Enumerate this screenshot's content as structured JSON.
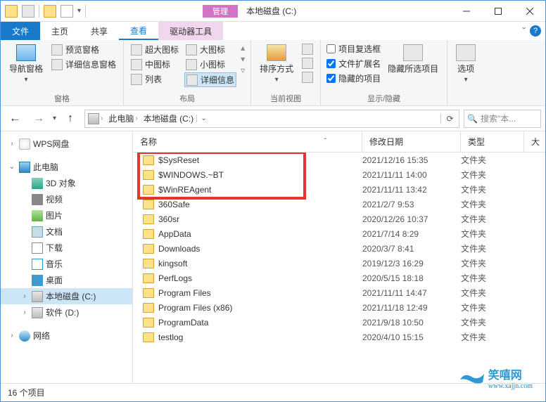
{
  "title": "本地磁盘 (C:)",
  "context_tab_header": "管理",
  "tabs": {
    "file": "文件",
    "home": "主页",
    "share": "共享",
    "view": "查看",
    "drive_tools": "驱动器工具"
  },
  "ribbon": {
    "nav_pane_label": "导航窗格",
    "preview_pane": "预览窗格",
    "details_pane": "详细信息窗格",
    "group_panes": "窗格",
    "extra_large_icons": "超大图标",
    "large_icons": "大图标",
    "medium_icons": "中图标",
    "small_icons": "小图标",
    "list": "列表",
    "details": "详细信息",
    "group_layout": "布局",
    "sort_by": "排序方式",
    "group_current_view": "当前视图",
    "item_checkboxes": "项目复选框",
    "file_ext": "文件扩展名",
    "hidden_items": "隐藏的项目",
    "hide_selected": "隐藏所选项目",
    "group_show_hide": "显示/隐藏",
    "options": "选项"
  },
  "breadcrumb": {
    "pc": "此电脑",
    "loc": "本地磁盘 (C:)"
  },
  "search_placeholder": "搜索\"本...",
  "sidebar": {
    "items": [
      {
        "label": "WPS网盘",
        "icon": "ic-wps",
        "tw": "›"
      },
      {
        "label": "此电脑",
        "icon": "ic-pc",
        "tw": "⌄"
      },
      {
        "label": "3D 对象",
        "icon": "ic-3d",
        "tw": ""
      },
      {
        "label": "视频",
        "icon": "ic-video",
        "tw": ""
      },
      {
        "label": "图片",
        "icon": "ic-pic",
        "tw": ""
      },
      {
        "label": "文档",
        "icon": "ic-doc",
        "tw": ""
      },
      {
        "label": "下载",
        "icon": "ic-dl",
        "tw": ""
      },
      {
        "label": "音乐",
        "icon": "ic-music",
        "tw": ""
      },
      {
        "label": "桌面",
        "icon": "ic-desk",
        "tw": ""
      },
      {
        "label": "本地磁盘 (C:)",
        "icon": "ic-drive",
        "tw": "›"
      },
      {
        "label": "软件 (D:)",
        "icon": "ic-drive",
        "tw": "›"
      },
      {
        "label": "网络",
        "icon": "ic-net",
        "tw": "›"
      }
    ]
  },
  "columns": {
    "name": "名称",
    "date": "修改日期",
    "type": "类型",
    "size": "大"
  },
  "rows": [
    {
      "name": "$SysReset",
      "date": "2021/12/16 15:35",
      "type": "文件夹"
    },
    {
      "name": "$WINDOWS.~BT",
      "date": "2021/11/11 14:00",
      "type": "文件夹"
    },
    {
      "name": "$WinREAgent",
      "date": "2021/11/11 13:42",
      "type": "文件夹"
    },
    {
      "name": "360Safe",
      "date": "2021/2/7 9:53",
      "type": "文件夹"
    },
    {
      "name": "360sr",
      "date": "2020/12/26 10:37",
      "type": "文件夹"
    },
    {
      "name": "AppData",
      "date": "2021/7/14 8:29",
      "type": "文件夹"
    },
    {
      "name": "Downloads",
      "date": "2020/3/7 8:41",
      "type": "文件夹"
    },
    {
      "name": "kingsoft",
      "date": "2019/12/3 16:29",
      "type": "文件夹"
    },
    {
      "name": "PerfLogs",
      "date": "2020/5/15 18:18",
      "type": "文件夹"
    },
    {
      "name": "Program Files",
      "date": "2021/11/11 14:47",
      "type": "文件夹"
    },
    {
      "name": "Program Files (x86)",
      "date": "2021/11/18 12:49",
      "type": "文件夹"
    },
    {
      "name": "ProgramData",
      "date": "2021/9/18 10:50",
      "type": "文件夹"
    },
    {
      "name": "testlog",
      "date": "2020/4/10 15:15",
      "type": "文件夹"
    }
  ],
  "highlight_range": [
    0,
    2
  ],
  "status": "16 个项目",
  "watermark": {
    "text": "笑嘻网",
    "url": "www.xajjn.com"
  }
}
